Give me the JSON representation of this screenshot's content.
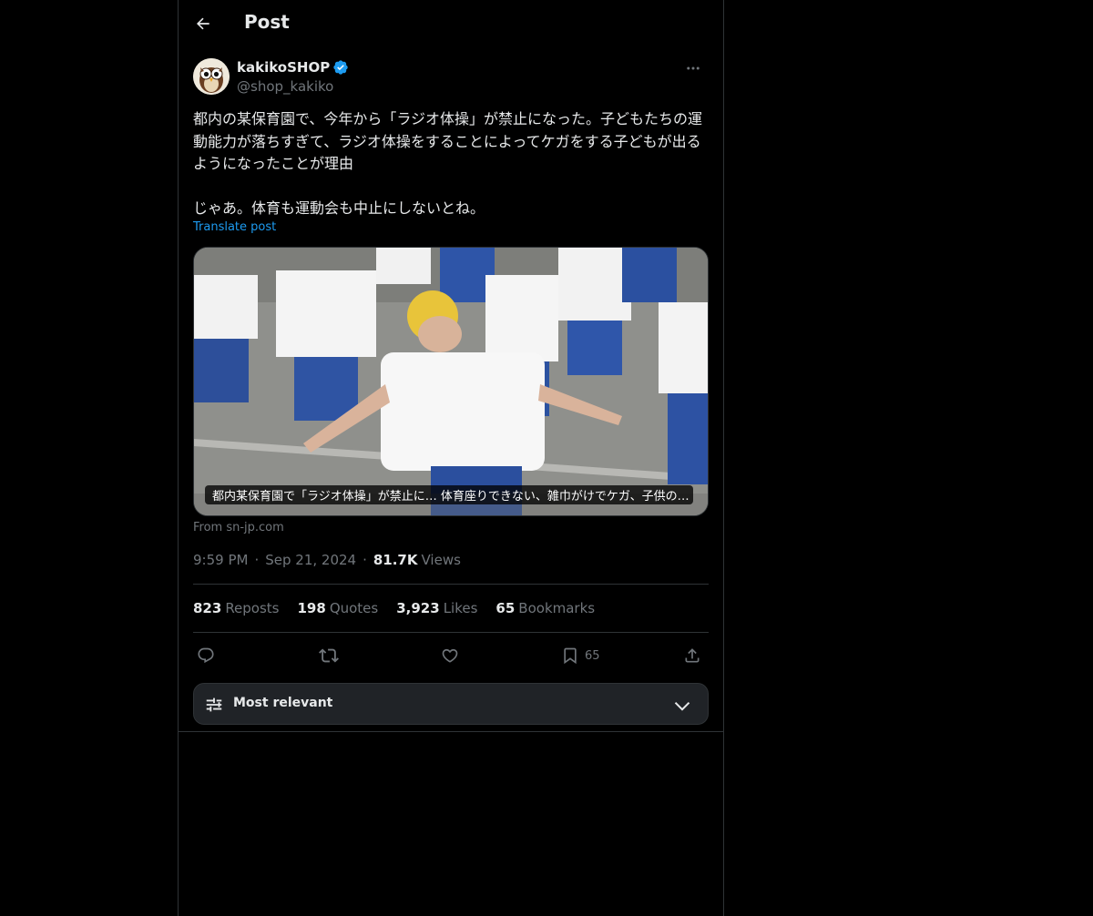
{
  "header": {
    "title": "Post",
    "back_icon": "arrow-left-icon"
  },
  "author": {
    "display_name": "kakikoSHOP",
    "handle": "@shop_kakiko",
    "verified": true,
    "verified_color": "#1d9bf0",
    "avatar_icon": "owl-avatar-icon"
  },
  "post": {
    "text": "都内の某保育園で、今年から「ラジオ体操」が禁止になった。子どもたちの運動能力が落ちすぎて、ラジオ体操をすることによってケガをする子どもが出るようになったことが理由\n\nじゃあ。体育も運動会も中止にしないとね。",
    "translate_label": "Translate post",
    "card_caption": "都内某保育園で「ラジオ体操」が禁止に… 体育座りできない、雑巾がけでケガ、子供の…",
    "source": "From sn-jp.com",
    "time": "9:59 PM",
    "date": "Sep 21, 2024",
    "views_count": "81.7K",
    "views_label": "Views"
  },
  "stats": {
    "reposts_count": "823",
    "reposts_label": "Reposts",
    "quotes_count": "198",
    "quotes_label": "Quotes",
    "likes_count": "3,923",
    "likes_label": "Likes",
    "bookmarks_count": "65",
    "bookmarks_label": "Bookmarks"
  },
  "actions": {
    "reply_icon": "reply-icon",
    "repost_icon": "repost-icon",
    "like_icon": "heart-icon",
    "bookmark_icon": "bookmark-icon",
    "bookmark_count": "65",
    "share_icon": "share-icon"
  },
  "replies_sort": {
    "label": "Most relevant",
    "icon": "sliders-icon",
    "chevron": "chevron-down-icon"
  },
  "colors": {
    "background": "#000000",
    "text": "#e7e9ea",
    "muted": "#71767b",
    "accent": "#1d9bf0",
    "border": "#2f3336"
  }
}
